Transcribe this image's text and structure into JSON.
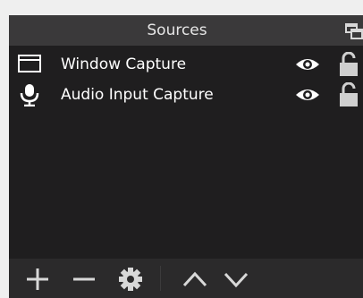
{
  "dock": {
    "title": "Sources",
    "undock_icon": "undock-icon"
  },
  "sources": [
    {
      "label": "Window Capture",
      "icon": "window-icon",
      "visible": true,
      "locked": false
    },
    {
      "label": "Audio Input Capture",
      "icon": "microphone-icon",
      "visible": true,
      "locked": false
    }
  ],
  "toolbar": {
    "buttons": [
      "plus-icon",
      "minus-icon",
      "gear-icon",
      "chevron-up-icon",
      "chevron-down-icon"
    ]
  },
  "colors": {
    "panel_bg": "#1f1e1f",
    "header_bg": "#3a393a",
    "toolbar_bg": "#2b2a2b",
    "text": "#ffffff"
  }
}
